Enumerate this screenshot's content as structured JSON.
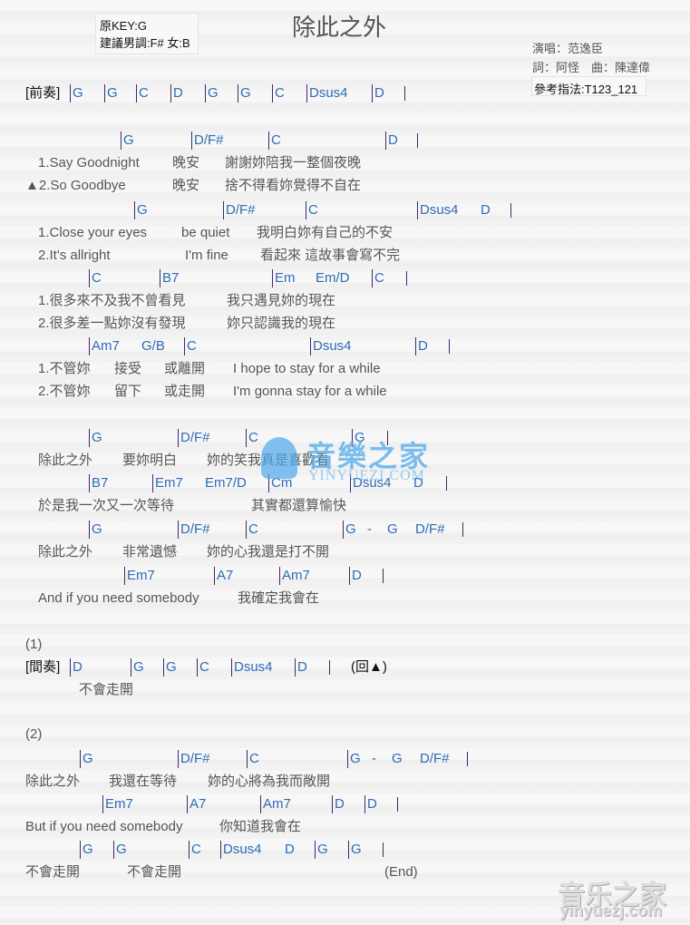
{
  "header": {
    "title": "除此之外",
    "original_key": "原KEY:G",
    "suggested_key": "建議男調:F# 女:B",
    "singer": "演唱：范逸臣",
    "credits": "詞：阿怪　曲：陳達偉",
    "fingering": "參考指法:T123_121"
  },
  "colors": {
    "chord": "#2d6bb3",
    "bar": "#4a2466",
    "lyric": "#555555"
  },
  "watermark": {
    "center_text": "音樂之家",
    "center_url": "YINYUEZI.COM",
    "corner_text": "音乐之家",
    "corner_url": "yinyuezj.com"
  },
  "lines": [
    [
      {
        "t": "label",
        "v": "[前奏]"
      },
      {
        "t": "bc",
        "v": "G"
      },
      {
        "t": "bc",
        "v": "G"
      },
      {
        "t": "bc",
        "v": "C"
      },
      {
        "t": "bc",
        "v": "D"
      },
      {
        "t": "bc",
        "v": "G"
      },
      {
        "t": "bc",
        "v": "G"
      },
      {
        "t": "bc",
        "v": "C"
      },
      {
        "t": "bc",
        "v": "Dsus4"
      },
      {
        "t": "bc",
        "v": "D"
      },
      {
        "t": "bar"
      }
    ],
    [
      {
        "t": "bc",
        "v": "G"
      },
      {
        "t": "bc",
        "v": "D/F#"
      },
      {
        "t": "bc",
        "v": "C"
      },
      {
        "t": "bc",
        "v": "D"
      },
      {
        "t": "bar"
      }
    ],
    [
      {
        "t": "ly",
        "v": "1.Say Goodnight"
      },
      {
        "t": "ly",
        "v": "晚安"
      },
      {
        "t": "ly",
        "v": "謝謝妳陪我一整個夜晚"
      }
    ],
    [
      {
        "t": "ly",
        "v": "▲2.So Goodbye"
      },
      {
        "t": "ly",
        "v": "晚安"
      },
      {
        "t": "ly",
        "v": "捨不得看妳覺得不自在"
      }
    ],
    [
      {
        "t": "bc",
        "v": "G"
      },
      {
        "t": "bc",
        "v": "D/F#"
      },
      {
        "t": "bc",
        "v": "C"
      },
      {
        "t": "bc",
        "v": "Dsus4"
      },
      {
        "t": "c",
        "v": "D"
      },
      {
        "t": "bar"
      }
    ],
    [
      {
        "t": "ly",
        "v": "1.Close your eyes"
      },
      {
        "t": "ly",
        "v": "be quiet"
      },
      {
        "t": "ly",
        "v": "我明白妳有自己的不安"
      }
    ],
    [
      {
        "t": "ly",
        "v": "2.It's allright"
      },
      {
        "t": "ly",
        "v": "I'm fine"
      },
      {
        "t": "ly",
        "v": "看起來 這故事會寫不完"
      }
    ],
    [
      {
        "t": "bc",
        "v": "C"
      },
      {
        "t": "bc",
        "v": "B7"
      },
      {
        "t": "bc",
        "v": "Em"
      },
      {
        "t": "c",
        "v": "Em/D"
      },
      {
        "t": "bc",
        "v": "C"
      },
      {
        "t": "bar"
      }
    ],
    [
      {
        "t": "ly",
        "v": "1.很多來不及我不曾看見"
      },
      {
        "t": "ly",
        "v": "我只遇見妳的現在"
      }
    ],
    [
      {
        "t": "ly",
        "v": "2.很多差一點妳沒有發現"
      },
      {
        "t": "ly",
        "v": "妳只認識我的現在"
      }
    ],
    [
      {
        "t": "bc",
        "v": "Am7"
      },
      {
        "t": "c",
        "v": "G/B"
      },
      {
        "t": "bc",
        "v": "C"
      },
      {
        "t": "bc",
        "v": "Dsus4"
      },
      {
        "t": "bc",
        "v": "D"
      },
      {
        "t": "bar"
      }
    ],
    [
      {
        "t": "ly",
        "v": "1.不管妳"
      },
      {
        "t": "ly",
        "v": "接受"
      },
      {
        "t": "ly",
        "v": "或離開"
      },
      {
        "t": "ly",
        "v": "I hope to stay for a while"
      }
    ],
    [
      {
        "t": "ly",
        "v": "2.不管妳"
      },
      {
        "t": "ly",
        "v": "留下"
      },
      {
        "t": "ly",
        "v": "或走開"
      },
      {
        "t": "ly",
        "v": "I'm gonna stay for a while"
      }
    ],
    [
      {
        "t": "bc",
        "v": "G"
      },
      {
        "t": "bc",
        "v": "D/F#"
      },
      {
        "t": "bc",
        "v": "C"
      },
      {
        "t": "bc",
        "v": "G"
      },
      {
        "t": "bar"
      }
    ],
    [
      {
        "t": "ly",
        "v": "除此之外"
      },
      {
        "t": "ly",
        "v": "要妳明白"
      },
      {
        "t": "ly",
        "v": "妳的笑我真是喜歡看"
      }
    ],
    [
      {
        "t": "bc",
        "v": "B7"
      },
      {
        "t": "bc",
        "v": "Em7"
      },
      {
        "t": "c",
        "v": "Em7/D"
      },
      {
        "t": "bc",
        "v": "Cm"
      },
      {
        "t": "bc",
        "v": "Dsus4"
      },
      {
        "t": "c",
        "v": "D"
      },
      {
        "t": "bar"
      }
    ],
    [
      {
        "t": "ly",
        "v": "於是我一次又一次等待"
      },
      {
        "t": "ly",
        "v": "其實都還算愉快"
      }
    ],
    [
      {
        "t": "bc",
        "v": "G"
      },
      {
        "t": "bc",
        "v": "D/F#"
      },
      {
        "t": "bc",
        "v": "C"
      },
      {
        "t": "bc",
        "v": "G"
      },
      {
        "t": "c",
        "v": "-"
      },
      {
        "t": "c",
        "v": "G"
      },
      {
        "t": "c",
        "v": "D/F#"
      },
      {
        "t": "bar"
      }
    ],
    [
      {
        "t": "ly",
        "v": "除此之外"
      },
      {
        "t": "ly",
        "v": "非常遺憾"
      },
      {
        "t": "ly",
        "v": "妳的心我還是打不開"
      }
    ],
    [
      {
        "t": "bc",
        "v": "Em7"
      },
      {
        "t": "bc",
        "v": "A7"
      },
      {
        "t": "bc",
        "v": "Am7"
      },
      {
        "t": "bc",
        "v": "D"
      },
      {
        "t": "bar"
      }
    ],
    [
      {
        "t": "ly",
        "v": "And if you need somebody"
      },
      {
        "t": "ly",
        "v": "我確定我會在"
      }
    ],
    [
      {
        "t": "ly",
        "v": "(1)"
      }
    ],
    [
      {
        "t": "label",
        "v": "[間奏]"
      },
      {
        "t": "bc",
        "v": "D"
      },
      {
        "t": "bc",
        "v": "G"
      },
      {
        "t": "bc",
        "v": "G"
      },
      {
        "t": "bc",
        "v": "C"
      },
      {
        "t": "bc",
        "v": "Dsus4"
      },
      {
        "t": "bc",
        "v": "D"
      },
      {
        "t": "bar"
      },
      {
        "t": "label",
        "v": "(回▲)"
      }
    ],
    [
      {
        "t": "ly",
        "v": "不會走開"
      }
    ],
    [
      {
        "t": "ly",
        "v": "(2)"
      }
    ],
    [
      {
        "t": "bc",
        "v": "G"
      },
      {
        "t": "bc",
        "v": "D/F#"
      },
      {
        "t": "bc",
        "v": "C"
      },
      {
        "t": "bc",
        "v": "G"
      },
      {
        "t": "c",
        "v": "-"
      },
      {
        "t": "c",
        "v": "G"
      },
      {
        "t": "c",
        "v": "D/F#"
      },
      {
        "t": "bar"
      }
    ],
    [
      {
        "t": "ly",
        "v": "除此之外"
      },
      {
        "t": "ly",
        "v": "我還在等待"
      },
      {
        "t": "ly",
        "v": "妳的心將為我而敞開"
      }
    ],
    [
      {
        "t": "bc",
        "v": "Em7"
      },
      {
        "t": "bc",
        "v": "A7"
      },
      {
        "t": "bc",
        "v": "Am7"
      },
      {
        "t": "bc",
        "v": "D"
      },
      {
        "t": "bc",
        "v": "D"
      },
      {
        "t": "bar"
      }
    ],
    [
      {
        "t": "ly",
        "v": "But if you need somebody"
      },
      {
        "t": "ly",
        "v": "你知道我會在"
      }
    ],
    [
      {
        "t": "bc",
        "v": "G"
      },
      {
        "t": "bc",
        "v": "G"
      },
      {
        "t": "bc",
        "v": "C"
      },
      {
        "t": "bc",
        "v": "Dsus4"
      },
      {
        "t": "c",
        "v": "D"
      },
      {
        "t": "bc",
        "v": "G"
      },
      {
        "t": "bc",
        "v": "G"
      },
      {
        "t": "bar"
      }
    ],
    [
      {
        "t": "ly",
        "v": "不會走開"
      },
      {
        "t": "ly",
        "v": "不會走開"
      },
      {
        "t": "ly",
        "v": "(End)"
      }
    ]
  ]
}
